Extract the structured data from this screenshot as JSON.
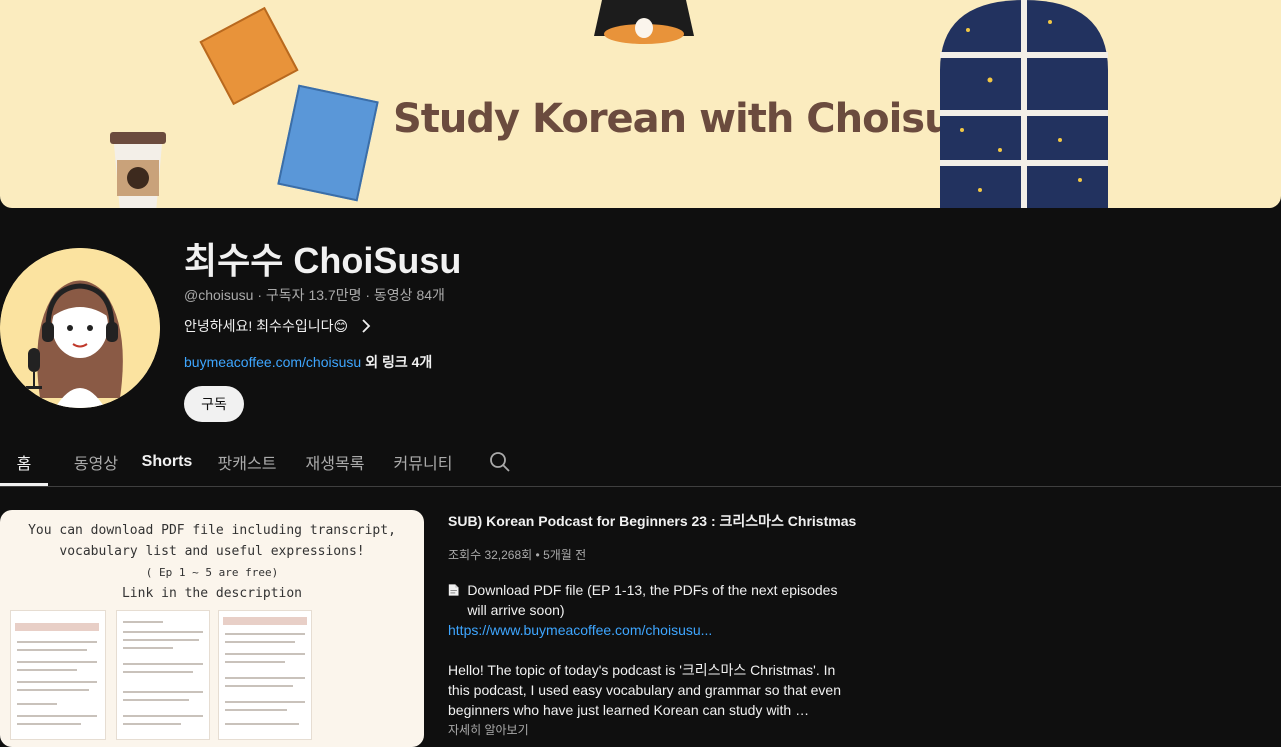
{
  "banner": {
    "title": "Study Korean with Choisusu"
  },
  "channel": {
    "name": "최수수 ChoiSusu",
    "handle": "@choisusu",
    "separator": " · ",
    "subscribers": "구독자 13.7만명",
    "videos": "동영상 84개",
    "description": "안녕하세요! 최수수입니다😊",
    "link_url": "buymeacoffee.com/choisusu",
    "more_links": "외 링크 4개",
    "subscribe_label": "구독"
  },
  "tabs": [
    {
      "label": "홈"
    },
    {
      "label": "동영상"
    },
    {
      "label": "Shorts"
    },
    {
      "label": "팟캐스트"
    },
    {
      "label": "재생목록"
    },
    {
      "label": "커뮤니티"
    }
  ],
  "featured": {
    "thumbnail_lines": [
      "You can download PDF file including transcript,",
      "vocabulary list and useful expressions!",
      "( Ep 1 ~ 5 are free)",
      "Link in the description"
    ],
    "title": "SUB) Korean Podcast for Beginners 23 : 크리스마스 Christmas",
    "stats": "조회수 32,268회 • 5개월 전",
    "desc_pdf": "Download PDF file (EP 1-13, the PDFs of the next episodes will arrive soon)",
    "desc_link": "https://www.buymeacoffee.com/choisusu...",
    "desc_body": "Hello! The topic of today's podcast is '크리스마스 Christmas'. In this podcast, I used easy vocabulary and grammar so that even beginners who have just learned Korean can study with …",
    "read_more": "자세히 알아보기"
  },
  "colors": {
    "background": "#0f0f0f",
    "banner_bg": "#fbecbf",
    "banner_text": "#6b4b3e",
    "link": "#3ea6ff"
  }
}
